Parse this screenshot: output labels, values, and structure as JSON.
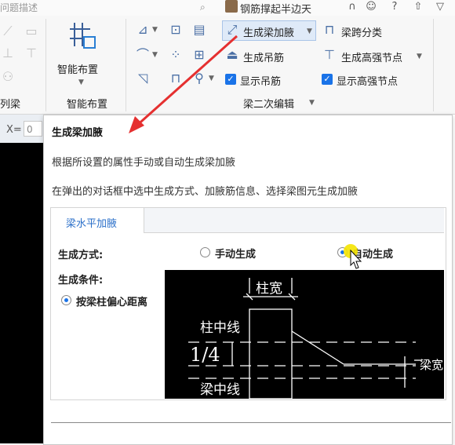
{
  "topbar": {
    "search_text": "问题描述",
    "user_text": "钢筋撑起半边天"
  },
  "ribbon": {
    "btn_generate_haunch": "生成梁加腋",
    "btn_span_classify": "梁跨分类",
    "btn_generate_hanger": "生成吊筋",
    "btn_generate_strong_node": "生成高强节点",
    "chk_show_hanger": "显示吊筋",
    "chk_show_strong_node": "显示高强节点",
    "group_secondary_edit": "梁二次编辑",
    "btn_smart_layout": "智能布置",
    "group_smart_layout": "智能布置",
    "left_fragment": "列梁"
  },
  "coords": {
    "x_label": "X=",
    "x_value": "0"
  },
  "tooltip": {
    "title": "生成梁加腋",
    "line1": "根据所设置的属性手动或自动生成梁加腋",
    "line2": "在弹出的对话框中选中生成方式、加腋筋信息、选择梁图元生成加腋",
    "tab": "梁水平加腋",
    "mode_label": "生成方式:",
    "mode_manual": "手动生成",
    "mode_auto": "自动生成",
    "cond_label": "生成条件:",
    "cond_option": "按梁柱偏心距离"
  },
  "diagram": {
    "col_width": "柱宽",
    "col_center": "柱中线",
    "ratio": "1/4",
    "beam_center": "梁中线",
    "side_text": "梁宽"
  }
}
